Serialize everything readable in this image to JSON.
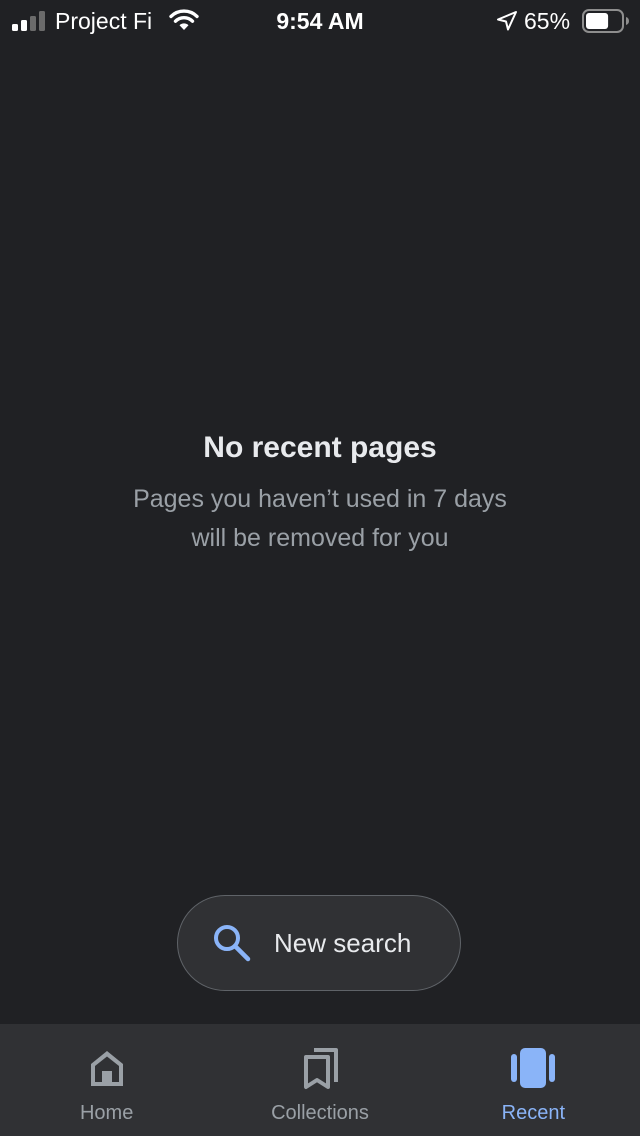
{
  "status_bar": {
    "carrier": "Project Fi",
    "time": "9:54 AM",
    "battery_percent": "65%",
    "battery_level": 0.65,
    "icons": [
      "signal-icon",
      "wifi-icon",
      "location-arrow-icon",
      "battery-icon"
    ]
  },
  "empty_state": {
    "title": "No recent pages",
    "subtitle_line1": "Pages you haven’t used in 7 days",
    "subtitle_line2": "will be removed for you"
  },
  "new_search": {
    "label": "New search",
    "icon": "search-icon"
  },
  "bottom_nav": {
    "items": [
      {
        "label": "Home",
        "icon": "home-icon",
        "active": false
      },
      {
        "label": "Collections",
        "icon": "collections-icon",
        "active": false
      },
      {
        "label": "Recent",
        "icon": "recent-icon",
        "active": true
      }
    ]
  },
  "colors": {
    "background": "#202124",
    "surface": "#303134",
    "accent": "#8ab4f8",
    "text_primary": "#e8eaed",
    "text_secondary": "#9aa0a6"
  }
}
